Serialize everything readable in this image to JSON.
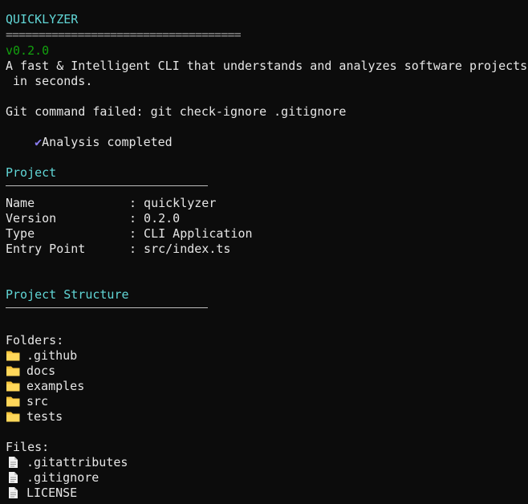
{
  "header": {
    "app_name": "QUICKLYZER",
    "rule": "====================================",
    "version": "v0.2.0",
    "tagline_1": "A fast & Intelligent CLI that understands and analyzes software projects",
    "tagline_2": " in seconds."
  },
  "messages": {
    "git_error": "Git command failed: git check-ignore .gitignore",
    "analysis_done": "Analysis completed"
  },
  "project": {
    "heading": "Project",
    "fields": [
      {
        "key": "Name",
        "value": ": quicklyzer"
      },
      {
        "key": "Version",
        "value": ": 0.2.0"
      },
      {
        "key": "Type",
        "value": ": CLI Application"
      },
      {
        "key": "Entry Point",
        "value": ": src/index.ts"
      }
    ]
  },
  "structure": {
    "heading": "Project Structure",
    "folders_label": "Folders:",
    "folders": [
      ".github",
      "docs",
      "examples",
      "src",
      "tests"
    ],
    "files_label": "Files:",
    "files": [
      ".gitattributes",
      ".gitignore",
      "LICENSE"
    ]
  },
  "colors": {
    "heading": "#61d6d6",
    "version": "#13a10e",
    "folder": "#f5c33b",
    "check": "#8a7cf0"
  },
  "icons": {
    "success": "check-icon",
    "folder": "folder-icon",
    "file": "file-icon"
  }
}
